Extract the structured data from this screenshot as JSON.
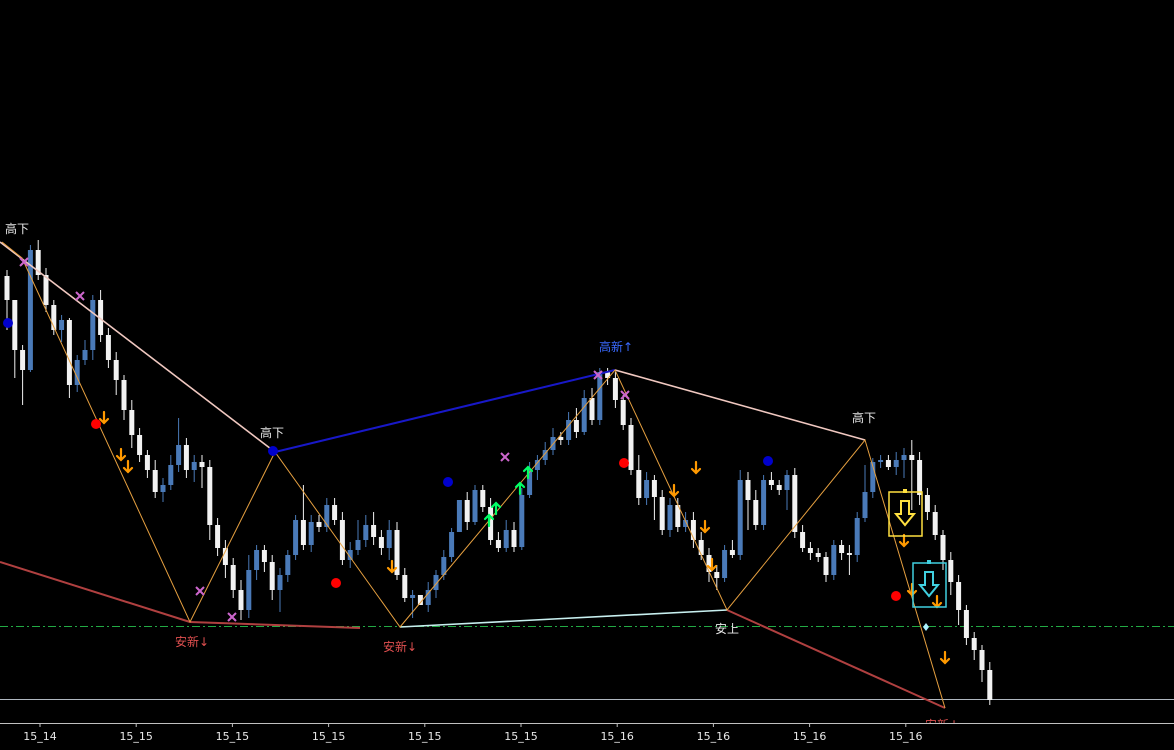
{
  "chart_data": {
    "type": "candlestick",
    "background": "#000000",
    "colors": {
      "bull": "#4a7ab8",
      "bear": "#f2f2f2",
      "zigzag": "#e6a040",
      "trend_down": "#f0c8c0",
      "trend_up_high": "#1818c8",
      "trend_up_low": "#c8f0f0",
      "support_down": "#b04040",
      "level_line": "#22aa44",
      "price_line": "#b0b8c0",
      "label": "#e8e8e8",
      "label_blue": "#3a6aff",
      "label_red": "#e05050",
      "sell_arrow": "#ff9900",
      "buy_arrow": "#00ff66",
      "cross": "#cc66cc",
      "dot_red": "#ff0000",
      "dot_blue": "#0000cc",
      "box_yellow": "#ffe040",
      "box_cyan": "#40d0e0"
    },
    "x_ticks": [
      "15_14",
      "15_15",
      "15_15",
      "15_15",
      "15_15",
      "15_15",
      "15_16",
      "15_16",
      "15_16",
      "15_16"
    ],
    "candles": [
      [
        276,
        300,
        270,
        330
      ],
      [
        300,
        350,
        340,
        378
      ],
      [
        350,
        370,
        345,
        405
      ],
      [
        370,
        250,
        245,
        372
      ],
      [
        250,
        275,
        240,
        280
      ],
      [
        275,
        305,
        268,
        312
      ],
      [
        305,
        330,
        300,
        335
      ],
      [
        330,
        320,
        315,
        342
      ],
      [
        320,
        385,
        318,
        398
      ],
      [
        385,
        360,
        355,
        392
      ],
      [
        360,
        350,
        340,
        365
      ],
      [
        350,
        300,
        295,
        360
      ],
      [
        300,
        335,
        290,
        342
      ],
      [
        335,
        360,
        328,
        368
      ],
      [
        360,
        380,
        352,
        395
      ],
      [
        380,
        410,
        375,
        420
      ],
      [
        410,
        435,
        400,
        448
      ],
      [
        435,
        455,
        428,
        462
      ],
      [
        455,
        470,
        450,
        478
      ],
      [
        470,
        492,
        460,
        498
      ],
      [
        492,
        485,
        478,
        502
      ],
      [
        485,
        465,
        455,
        490
      ],
      [
        465,
        445,
        418,
        472
      ],
      [
        445,
        470,
        438,
        478
      ],
      [
        470,
        462,
        455,
        482
      ],
      [
        462,
        467,
        455,
        488
      ],
      [
        467,
        525,
        460,
        540
      ],
      [
        525,
        548,
        518,
        556
      ],
      [
        548,
        565,
        540,
        578
      ],
      [
        565,
        590,
        558,
        598
      ],
      [
        590,
        610,
        580,
        620
      ],
      [
        610,
        570,
        555,
        618
      ],
      [
        570,
        550,
        545,
        580
      ],
      [
        550,
        562,
        545,
        572
      ],
      [
        562,
        590,
        555,
        600
      ],
      [
        590,
        575,
        568,
        612
      ],
      [
        575,
        555,
        550,
        582
      ],
      [
        555,
        520,
        515,
        560
      ],
      [
        520,
        545,
        485,
        550
      ],
      [
        545,
        522,
        515,
        552
      ],
      [
        522,
        527,
        515,
        532
      ],
      [
        527,
        505,
        498,
        532
      ],
      [
        505,
        520,
        498,
        525
      ],
      [
        520,
        560,
        512,
        565
      ],
      [
        560,
        550,
        542,
        568
      ],
      [
        550,
        540,
        520,
        555
      ],
      [
        540,
        525,
        515,
        547
      ],
      [
        525,
        537,
        512,
        545
      ],
      [
        537,
        548,
        530,
        555
      ],
      [
        548,
        530,
        520,
        560
      ],
      [
        530,
        575,
        522,
        580
      ],
      [
        575,
        598,
        568,
        602
      ],
      [
        598,
        595,
        590,
        618
      ],
      [
        595,
        605,
        598,
        605
      ],
      [
        605,
        590,
        582,
        612
      ],
      [
        590,
        575,
        570,
        598
      ],
      [
        575,
        557,
        550,
        580
      ],
      [
        557,
        532,
        528,
        562
      ],
      [
        532,
        500,
        520,
        508
      ],
      [
        500,
        522,
        492,
        530
      ],
      [
        522,
        490,
        485,
        525
      ],
      [
        490,
        507,
        485,
        512
      ],
      [
        507,
        540,
        498,
        545
      ],
      [
        540,
        548,
        532,
        552
      ],
      [
        548,
        530,
        520,
        552
      ],
      [
        530,
        547,
        522,
        552
      ],
      [
        547,
        495,
        488,
        550
      ],
      [
        495,
        470,
        462,
        498
      ],
      [
        470,
        460,
        455,
        480
      ],
      [
        460,
        450,
        442,
        465
      ],
      [
        450,
        437,
        428,
        455
      ],
      [
        437,
        440,
        432,
        445
      ],
      [
        440,
        420,
        412,
        445
      ],
      [
        420,
        432,
        408,
        438
      ],
      [
        432,
        398,
        390,
        435
      ],
      [
        398,
        420,
        388,
        425
      ],
      [
        420,
        372,
        368,
        425
      ],
      [
        372,
        378,
        368,
        385
      ],
      [
        378,
        400,
        372,
        408
      ],
      [
        400,
        425,
        395,
        430
      ],
      [
        425,
        470,
        418,
        475
      ],
      [
        470,
        498,
        455,
        505
      ],
      [
        498,
        480,
        472,
        505
      ],
      [
        480,
        497,
        475,
        520
      ],
      [
        497,
        530,
        490,
        535
      ],
      [
        530,
        505,
        498,
        537
      ],
      [
        505,
        527,
        498,
        532
      ],
      [
        527,
        520,
        512,
        532
      ],
      [
        520,
        540,
        512,
        548
      ],
      [
        540,
        555,
        532,
        560
      ],
      [
        555,
        572,
        548,
        582
      ],
      [
        572,
        578,
        565,
        590
      ],
      [
        578,
        550,
        545,
        582
      ],
      [
        550,
        555,
        540,
        558
      ],
      [
        555,
        480,
        470,
        560
      ],
      [
        480,
        500,
        472,
        530
      ],
      [
        500,
        525,
        490,
        530
      ],
      [
        525,
        480,
        475,
        530
      ],
      [
        480,
        485,
        472,
        490
      ],
      [
        485,
        490,
        480,
        495
      ],
      [
        490,
        475,
        470,
        510
      ],
      [
        475,
        532,
        468,
        538
      ],
      [
        532,
        548,
        525,
        552
      ],
      [
        548,
        553,
        542,
        560
      ],
      [
        553,
        557,
        548,
        562
      ],
      [
        557,
        575,
        552,
        582
      ],
      [
        575,
        545,
        540,
        580
      ],
      [
        545,
        553,
        540,
        560
      ],
      [
        553,
        555,
        545,
        575
      ],
      [
        555,
        518,
        512,
        562
      ],
      [
        518,
        492,
        465,
        522
      ],
      [
        492,
        462,
        458,
        498
      ],
      [
        462,
        460,
        455,
        468
      ],
      [
        460,
        467,
        455,
        470
      ],
      [
        467,
        460,
        452,
        475
      ],
      [
        460,
        455,
        448,
        478
      ],
      [
        455,
        460,
        440,
        510
      ],
      [
        460,
        495,
        452,
        505
      ],
      [
        495,
        512,
        488,
        520
      ],
      [
        512,
        535,
        505,
        540
      ],
      [
        535,
        560,
        530,
        570
      ],
      [
        560,
        582,
        552,
        595
      ],
      [
        582,
        610,
        575,
        625
      ],
      [
        610,
        638,
        605,
        645
      ],
      [
        638,
        650,
        632,
        660
      ],
      [
        650,
        670,
        645,
        682
      ],
      [
        670,
        700,
        662,
        705
      ]
    ],
    "zigzag": [
      [
        2,
        242
      ],
      [
        22,
        258
      ],
      [
        190,
        622
      ],
      [
        275,
        452
      ],
      [
        400,
        627
      ],
      [
        615,
        370
      ],
      [
        727,
        610
      ],
      [
        865,
        440
      ],
      [
        945,
        708
      ]
    ],
    "trend_lines": [
      {
        "role": "trend_down",
        "points": [
          [
            0,
            242
          ],
          [
            275,
            452
          ]
        ]
      },
      {
        "role": "trend_up_high",
        "points": [
          [
            275,
            452
          ],
          [
            615,
            370
          ]
        ]
      },
      {
        "role": "trend_down",
        "points": [
          [
            615,
            370
          ],
          [
            865,
            440
          ]
        ]
      },
      {
        "role": "support_down",
        "points": [
          [
            0,
            562
          ],
          [
            190,
            622
          ]
        ]
      },
      {
        "role": "support_down",
        "points": [
          [
            190,
            622
          ],
          [
            360,
            628
          ]
        ]
      },
      {
        "role": "trend_up_low",
        "points": [
          [
            400,
            627
          ],
          [
            727,
            610
          ]
        ]
      },
      {
        "role": "support_down",
        "points": [
          [
            727,
            610
          ],
          [
            945,
            708
          ]
        ]
      }
    ],
    "labels": [
      {
        "text": "高下",
        "x": 17,
        "y": 233,
        "role": "label"
      },
      {
        "text": "高下",
        "x": 272,
        "y": 437,
        "role": "label"
      },
      {
        "text": "高新↑",
        "x": 616,
        "y": 351,
        "role": "label_blue"
      },
      {
        "text": "高下",
        "x": 864,
        "y": 422,
        "role": "label"
      },
      {
        "text": "安新↓",
        "x": 192,
        "y": 646,
        "role": "label_red"
      },
      {
        "text": "安新↓",
        "x": 400,
        "y": 651,
        "role": "label_red"
      },
      {
        "text": "安上",
        "x": 727,
        "y": 633,
        "role": "label"
      },
      {
        "text": "安新↓",
        "x": 942,
        "y": 729,
        "role": "label_red"
      }
    ],
    "sell_arrows": [
      [
        104,
        418
      ],
      [
        121,
        455
      ],
      [
        128,
        467
      ],
      [
        392,
        567
      ],
      [
        674,
        491
      ],
      [
        696,
        468
      ],
      [
        705,
        527
      ],
      [
        712,
        565
      ],
      [
        904,
        541
      ],
      [
        912,
        590
      ],
      [
        937,
        602
      ],
      [
        945,
        658
      ]
    ],
    "buy_arrows": [
      [
        489,
        520
      ],
      [
        496,
        508
      ],
      [
        520,
        488
      ],
      [
        528,
        472
      ]
    ],
    "crosses": [
      [
        24,
        262
      ],
      [
        80,
        296
      ],
      [
        200,
        591
      ],
      [
        232,
        617
      ],
      [
        505,
        457
      ],
      [
        598,
        375
      ],
      [
        625,
        395
      ]
    ],
    "dots_red": [
      [
        96,
        424
      ],
      [
        336,
        583
      ],
      [
        624,
        463
      ],
      [
        896,
        596
      ]
    ],
    "dots_blue": [
      [
        8,
        323
      ],
      [
        273,
        451
      ],
      [
        448,
        482
      ],
      [
        768,
        461
      ]
    ],
    "boxes": [
      {
        "role": "box_yellow",
        "x": 905,
        "y": 514
      },
      {
        "role": "box_cyan",
        "x": 929,
        "y": 585
      }
    ]
  }
}
